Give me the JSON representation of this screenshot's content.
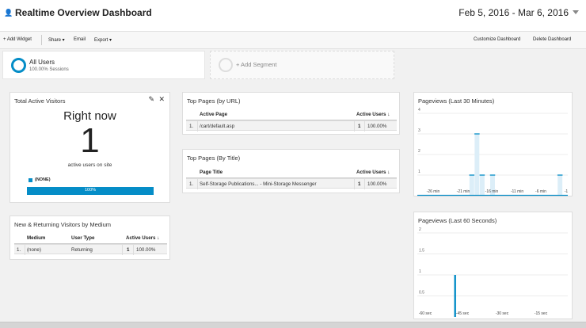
{
  "header": {
    "title": "Realtime Overview Dashboard",
    "date_range": "Feb 5, 2016 - Mar 6, 2016"
  },
  "toolbar": {
    "add_widget": "+ Add Widget",
    "share": "Share ▾",
    "email": "Email",
    "export": "Export ▾",
    "customize": "Customize Dashboard",
    "delete": "Delete Dashboard"
  },
  "segments": {
    "all_users": "All Users",
    "all_users_sub": "100.00% Sessions",
    "add_segment": "+ Add Segment"
  },
  "colors": {
    "accent": "#058dc7",
    "bar_fill": "#dceef8"
  },
  "active_visitors": {
    "title": "Total Active Visitors",
    "label": "Right now",
    "count": "1",
    "sub": "active users on site",
    "legend": "(NONE)",
    "bar_label": "100%",
    "bar_fraction": 1.0
  },
  "top_url": {
    "title": "Top Pages (by URL)",
    "col1": "Active Page",
    "col2": "Active Users ↓",
    "rows": [
      {
        "idx": "1.",
        "page": "/cart/default.asp",
        "users": "1",
        "pct": "100.00%"
      }
    ]
  },
  "top_title": {
    "title": "Top Pages (By Title)",
    "col1": "Page Title",
    "col2": "Active Users ↓",
    "rows": [
      {
        "idx": "1.",
        "page": "Self-Storage Publications... - Mini-Storage Messenger",
        "users": "1",
        "pct": "100.00%"
      }
    ]
  },
  "medium": {
    "title": "New & Returning Visitors by Medium",
    "col1": "Medium",
    "col2": "User Type",
    "col3": "Active Users ↓",
    "rows": [
      {
        "idx": "1.",
        "medium": "(none)",
        "type": "Returning",
        "users": "1",
        "pct": "100.00%"
      }
    ]
  },
  "chart_data": [
    {
      "type": "area",
      "title": "Pageviews (Last 30 Minutes)",
      "ylim": [
        0,
        4
      ],
      "yticks": [
        "4",
        "3",
        "2",
        "1"
      ],
      "xticks": [
        "-26 min",
        "-21 min",
        "-16 min",
        "-11 min",
        "-6 min",
        "-1"
      ],
      "x": [
        -29,
        -28,
        -27,
        -26,
        -25,
        -24,
        -23,
        -22,
        -21,
        -20,
        -19,
        -18,
        -17,
        -16,
        -15,
        -14,
        -13,
        -12,
        -11,
        -10,
        -9,
        -8,
        -7,
        -6,
        -5,
        -4,
        -3,
        -2,
        -1
      ],
      "values": [
        0,
        0,
        0,
        0,
        0,
        0,
        0,
        0,
        0,
        0,
        1,
        3,
        1,
        0,
        1,
        0,
        0,
        0,
        0,
        0,
        0,
        0,
        0,
        0,
        0,
        0,
        0,
        1,
        0
      ]
    },
    {
      "type": "bar",
      "title": "Pageviews (Last 60 Seconds)",
      "ylim": [
        0,
        2
      ],
      "yticks": [
        "2",
        "1.5",
        "1",
        "0.5"
      ],
      "xticks": [
        "-60 sec",
        "-45 sec",
        "-30 sec",
        "-15 sec"
      ],
      "x": [
        -45
      ],
      "values": [
        1
      ]
    }
  ]
}
